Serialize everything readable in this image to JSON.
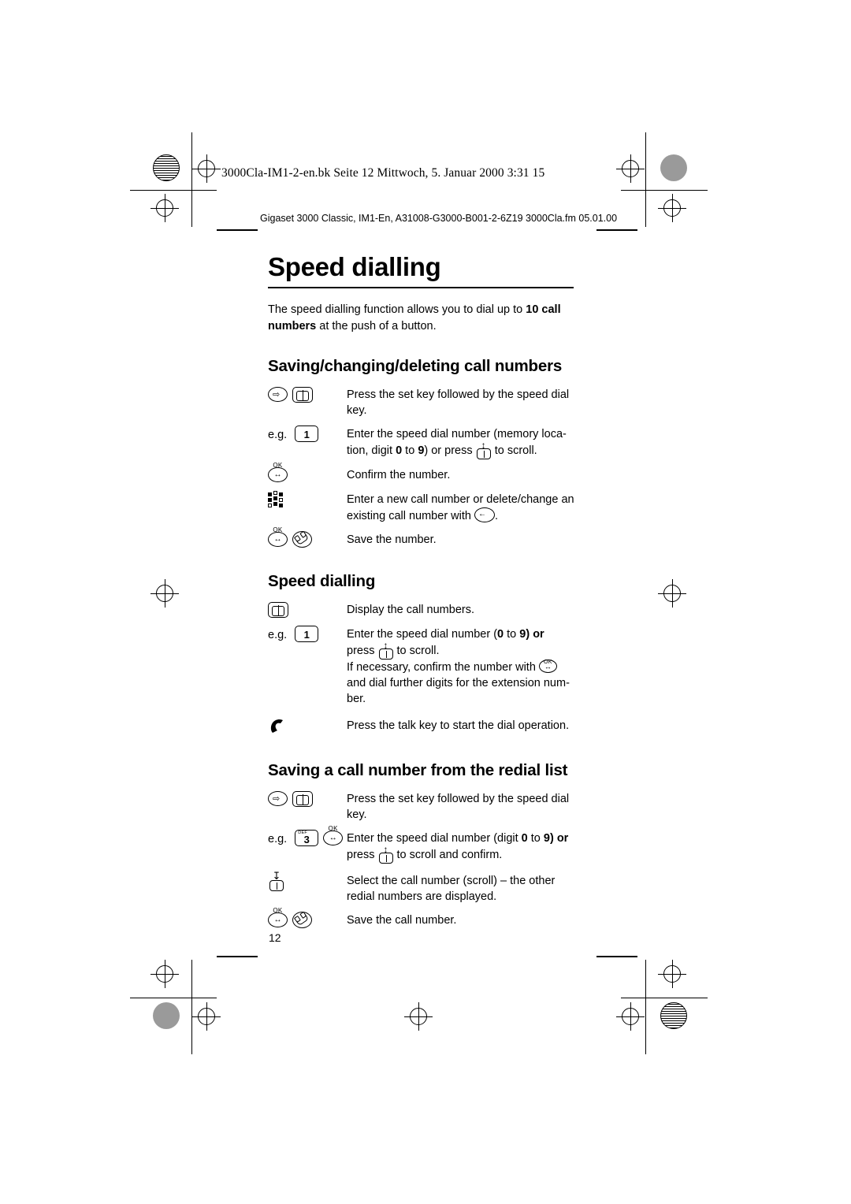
{
  "header": {
    "line1": "3000Cla-IM1-2-en.bk  Seite 12  Mittwoch, 5. Januar 2000  3:31 15",
    "line2": "Gigaset 3000 Classic, IM1-En, A31008-G3000-B001-2-6Z19  3000Cla.fm    05.01.00"
  },
  "page": {
    "title": "Speed dialling",
    "intro_part1": "The speed dialling function allows you to dial up to ",
    "intro_bold1": "10 call numbers",
    "intro_part2": " at the push of a button.",
    "page_number": "12"
  },
  "sections": [
    {
      "heading": "Saving/changing/deleting call numbers",
      "steps": [
        {
          "eg": "",
          "text": "Press the set key followed by the speed dial key."
        },
        {
          "eg": "e.g.",
          "key_digit": "1",
          "text_a": "Enter the speed dial number (memory loca-tion, digit ",
          "text_b0": "0",
          "text_b1": " to ",
          "text_b2": "9",
          "text_b3": ") or press",
          "text_c": "to scroll."
        },
        {
          "eg": "",
          "text": "Confirm the number."
        },
        {
          "eg": "",
          "text_a": "Enter a new call number or delete/change an existing call number with",
          "text_b": "."
        },
        {
          "eg": "",
          "text": "Save the number."
        }
      ]
    },
    {
      "heading": "Speed dialling",
      "steps": [
        {
          "text": "Display the call numbers."
        },
        {
          "eg": "e.g.",
          "key_digit": "1",
          "line1_a": "Enter the speed dial number (",
          "line1_b0": "0",
          "line1_b1": " to ",
          "line1_b2": "9",
          "line1_b3": ") or",
          "line2_a": "press",
          "line2_b": "to scroll.",
          "line3_a": "If necessary, confirm the number with",
          "line4": "and dial further digits for the extension num-ber."
        },
        {
          "text": "Press the talk key to start the dial operation."
        }
      ]
    },
    {
      "heading": "Saving a call number from the redial list",
      "steps": [
        {
          "text": "Press the set key followed by the speed dial key."
        },
        {
          "eg": "e.g.",
          "key_digit": "3",
          "key_sup": "DEF",
          "line1_a": "Enter the speed dial number (digit ",
          "line1_b0": "0",
          "line1_b1": " to ",
          "line1_b2": "9",
          "line1_b3": ") or",
          "line2_a": "press",
          "line2_b": "to scroll and confirm."
        },
        {
          "text": "Select the call number (scroll) – the other redial numbers are displayed."
        },
        {
          "text": "Save the call number."
        }
      ]
    }
  ],
  "keys": {
    "ok_label": "OK",
    "digit1_sup": "",
    "digit1": "1",
    "digit3_sup": "DEF",
    "digit3": "3"
  }
}
